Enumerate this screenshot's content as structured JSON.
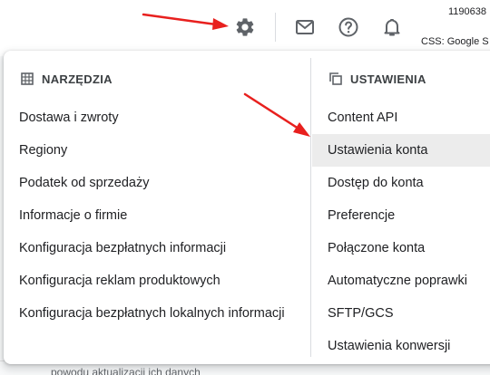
{
  "topbar": {
    "account_id": "1190638",
    "css_label": "CSS: Google S",
    "icons": [
      "gear-icon",
      "mail-icon",
      "help-icon",
      "bell-icon"
    ]
  },
  "background": {
    "partial_text": "powodu aktualizacji ich danych"
  },
  "tools": {
    "header": "NARZĘDZIA",
    "items": [
      "Dostawa i zwroty",
      "Regiony",
      "Podatek od sprzedaży",
      "Informacje o firmie",
      "Konfiguracja bezpłatnych informacji",
      "Konfiguracja reklam produktowych",
      "Konfiguracja bezpłatnych lokalnych informacji"
    ]
  },
  "settings": {
    "header": "USTAWIENIA",
    "items": [
      "Content API",
      "Ustawienia konta",
      "Dostęp do konta",
      "Preferencje",
      "Połączone konta",
      "Automatyczne poprawki",
      "SFTP/GCS",
      "Ustawienia konwersji"
    ],
    "highlighted_item": "Ustawienia konta"
  },
  "colors": {
    "arrow": "#e8201e",
    "highlight": "#ececec",
    "divider": "#dadce0"
  }
}
